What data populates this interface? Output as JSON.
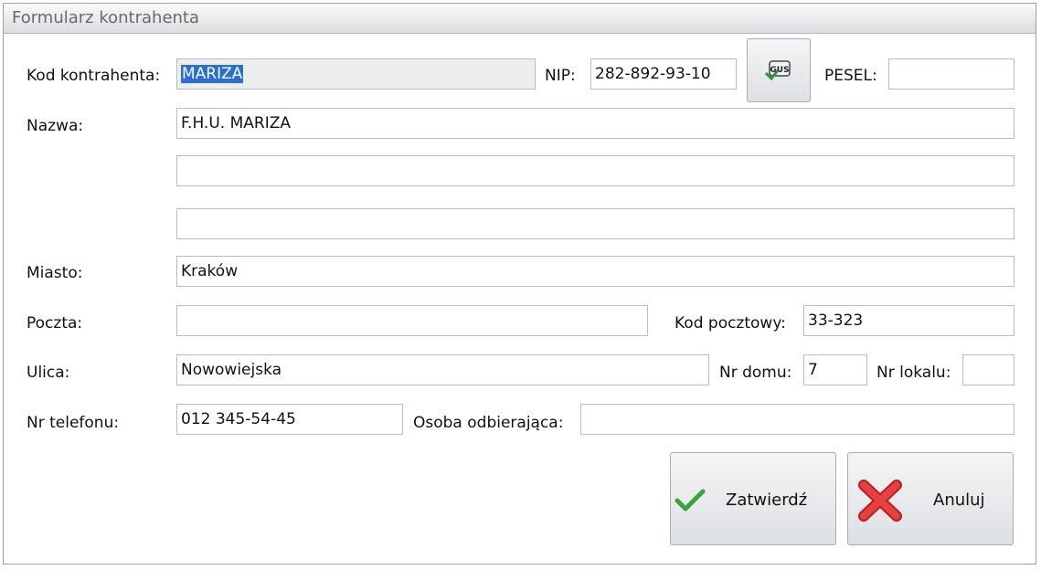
{
  "window": {
    "title": "Formularz kontrahenta"
  },
  "form": {
    "kod_label": "Kod kontrahenta:",
    "kod_value": "MARIZA",
    "nip_label": "NIP:",
    "nip_value": "282-892-93-10",
    "gus_button_text": "GUS",
    "pesel_label": "PESEL:",
    "pesel_value": "",
    "nazwa_label": "Nazwa:",
    "nazwa_lines": [
      "F.H.U. MARIZA",
      "",
      ""
    ],
    "miasto_label": "Miasto:",
    "miasto_value": "Kraków",
    "poczta_label": "Poczta:",
    "poczta_value": "",
    "kod_pocztowy_label": "Kod pocztowy:",
    "kod_pocztowy_value": "33-323",
    "ulica_label": "Ulica:",
    "ulica_value": "Nowowiejska",
    "nr_domu_label": "Nr domu:",
    "nr_domu_value": "7",
    "nr_lokalu_label": "Nr lokalu:",
    "nr_lokalu_value": "",
    "telefon_label": "Nr telefonu:",
    "telefon_value": "012 345-54-45",
    "osoba_label": "Osoba odbierająca:",
    "osoba_value": ""
  },
  "buttons": {
    "confirm_label": "Zatwierdź",
    "cancel_label": "Anuluj"
  },
  "colors": {
    "selection": "#2a6fd6",
    "confirm_icon": "#3aa63a",
    "cancel_icon": "#e03030"
  }
}
